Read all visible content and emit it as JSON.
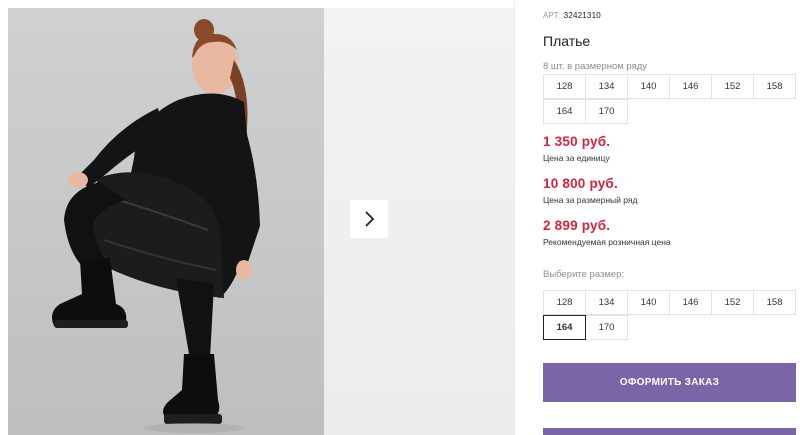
{
  "product": {
    "sku_label": "АРТ:",
    "sku_value": "32421310",
    "title": "Платье"
  },
  "pack": {
    "label": "8 шт. в размерном ряду",
    "sizes_row1": [
      "128",
      "134",
      "140",
      "146",
      "152",
      "158"
    ],
    "sizes_row2": [
      "164",
      "170"
    ]
  },
  "prices": {
    "unit_price": "1 350 руб.",
    "unit_note": "Цена за единицу",
    "pack_price": "10 800 руб.",
    "pack_note": "Цена за размерный ряд",
    "retail_price": "2 899 руб.",
    "retail_note": "Рекомендуемая розничная цена"
  },
  "select": {
    "label": "Выберите размер:",
    "sizes_row1": [
      "128",
      "134",
      "140",
      "146",
      "152",
      "158"
    ],
    "sizes_row2": [
      "164",
      "170"
    ],
    "selected": "164"
  },
  "actions": {
    "order_label": "ОФОРМИТЬ ЗАКАЗ"
  },
  "icons": {
    "next": "chevron-right-icon"
  },
  "colors": {
    "accent": "#7a66a6",
    "price": "#d4243e"
  }
}
